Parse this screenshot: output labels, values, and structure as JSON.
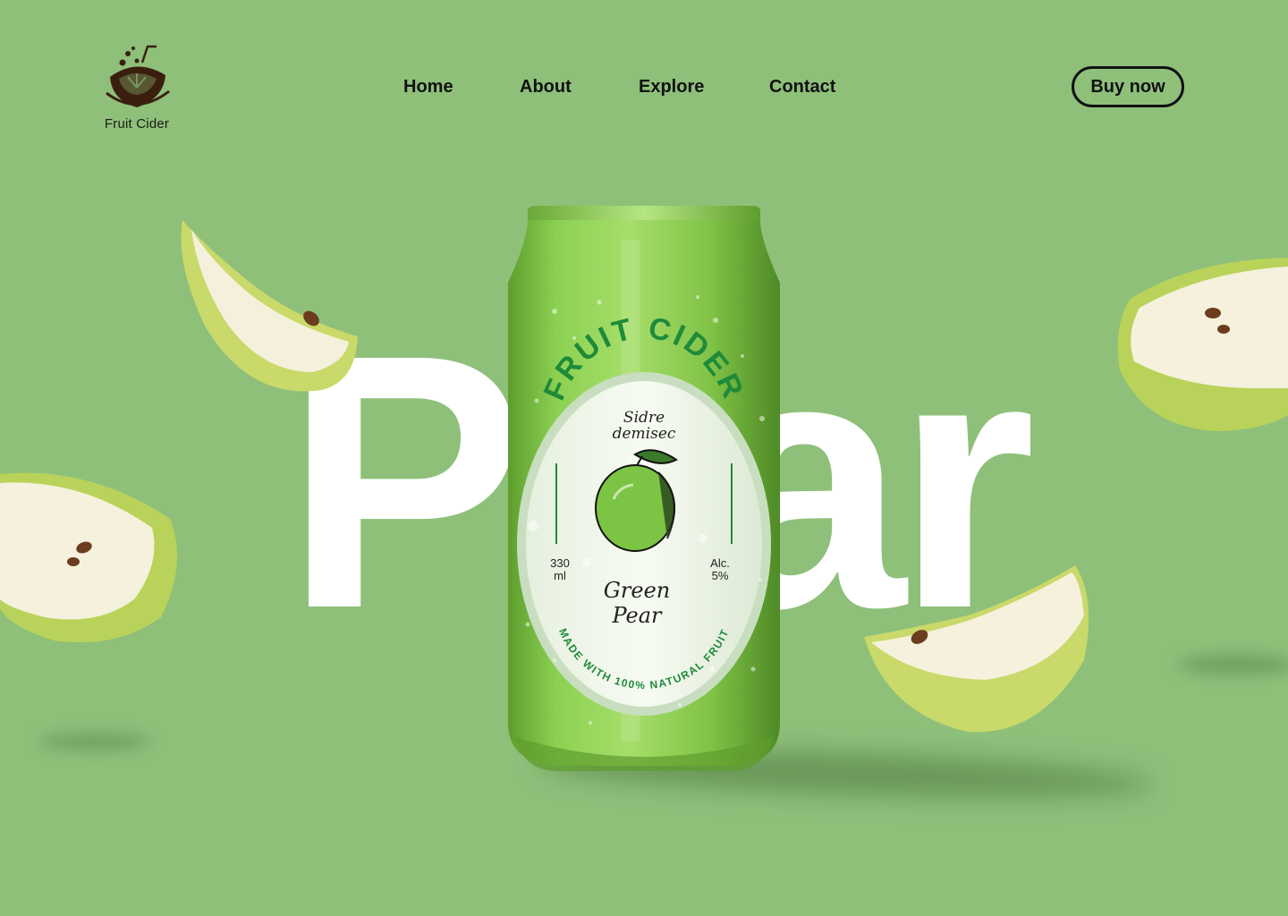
{
  "brand": {
    "name": "Fruit Cider",
    "logo_icon": "cider-bowl-icon"
  },
  "nav": {
    "items": [
      {
        "label": "Home"
      },
      {
        "label": "About"
      },
      {
        "label": "Explore"
      },
      {
        "label": "Contact"
      }
    ],
    "cta_label": "Buy now"
  },
  "hero": {
    "word": "Pear"
  },
  "can_label": {
    "brand": "FRUIT CIDER",
    "style_line1": "Sidre",
    "style_line2": "demisec",
    "volume_number": "330",
    "volume_unit": "ml",
    "alcohol_label": "Alc.",
    "alcohol_value": "5%",
    "flavor_line1": "Green",
    "flavor_line2": "Pear",
    "tagline": "MADE WITH 100% NATURAL FRUIT"
  },
  "colors": {
    "background": "#8ec07a",
    "can_green": "#7fc246",
    "label_green": "#1e8a3a",
    "text_dark": "#111111",
    "hero_text": "#ffffff"
  }
}
